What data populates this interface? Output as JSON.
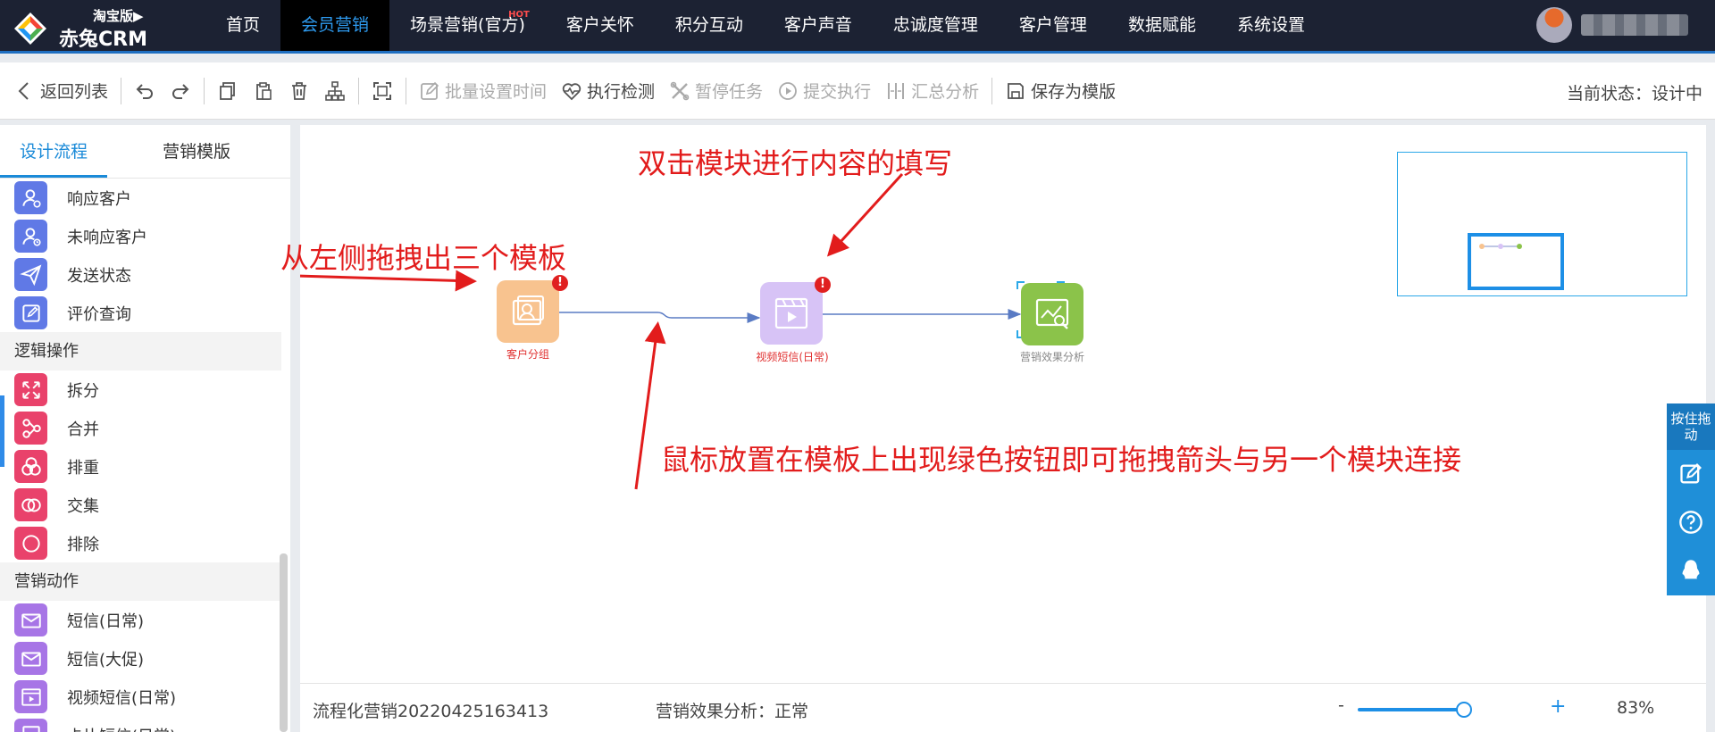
{
  "brand": {
    "edition": "淘宝版▶",
    "name": "赤兔CRM"
  },
  "nav": {
    "items": [
      {
        "label": "首页"
      },
      {
        "label": "会员营销",
        "active": true
      },
      {
        "label": "场景营销(官方)",
        "badge": "HOT"
      },
      {
        "label": "客户关怀"
      },
      {
        "label": "积分互动"
      },
      {
        "label": "客户声音"
      },
      {
        "label": "忠诚度管理"
      },
      {
        "label": "客户管理"
      },
      {
        "label": "数据赋能"
      },
      {
        "label": "系统设置"
      }
    ]
  },
  "toolbar": {
    "back": "返回列表",
    "batch_time": "批量设置时间",
    "exec_check": "执行检测",
    "pause_task": "暂停任务",
    "submit_exec": "提交执行",
    "summary": "汇总分析",
    "save_template": "保存为模版",
    "status": "当前状态：设计中"
  },
  "sidebar": {
    "tabs": [
      "设计流程",
      "营销模版"
    ],
    "items_top": [
      {
        "label": "响应客户",
        "icon": "user-check-icon"
      },
      {
        "label": "未响应客户",
        "icon": "user-clock-icon"
      },
      {
        "label": "发送状态",
        "icon": "paper-plane-icon"
      },
      {
        "label": "评价查询",
        "icon": "edit-icon"
      }
    ],
    "group_logic": "逻辑操作",
    "items_logic": [
      {
        "label": "拆分",
        "icon": "split-icon"
      },
      {
        "label": "合并",
        "icon": "merge-icon"
      },
      {
        "label": "排重",
        "icon": "dedupe-icon"
      },
      {
        "label": "交集",
        "icon": "intersect-icon"
      },
      {
        "label": "排除",
        "icon": "exclude-icon"
      }
    ],
    "group_action": "营销动作",
    "items_action": [
      {
        "label": "短信(日常)",
        "icon": "mail-icon"
      },
      {
        "label": "短信(大促)",
        "icon": "mail-icon"
      },
      {
        "label": "视频短信(日常)",
        "icon": "video-sms-icon"
      },
      {
        "label": "卡片短信(日常)",
        "icon": "card-sms-icon"
      }
    ]
  },
  "canvas": {
    "annotations": {
      "drag_templates": "从左侧拖拽出三个模板",
      "double_click": "双击模块进行内容的填写",
      "connect_hint": "鼠标放置在模板上出现绿色按钮即可拖拽箭头与另一个模块连接"
    },
    "nodes": [
      {
        "label": "客户分组",
        "color": "#f8c38f",
        "label_color": "#e03030",
        "error": "!"
      },
      {
        "label": "视频短信(日常)",
        "color": "#d7c3f6",
        "label_color": "#e03030",
        "error": "!"
      },
      {
        "label": "营销效果分析",
        "color": "#8bc34a",
        "label_color": "#888888"
      }
    ]
  },
  "bottombar": {
    "flow_name": "流程化营销20220425163413",
    "analysis_status": "营销效果分析：正常",
    "zoom_minus": "-",
    "zoom_plus": "+",
    "zoom_value": "83%",
    "zoom_fraction": 0.83
  },
  "float_panel": {
    "drag_label": "按住拖动"
  }
}
